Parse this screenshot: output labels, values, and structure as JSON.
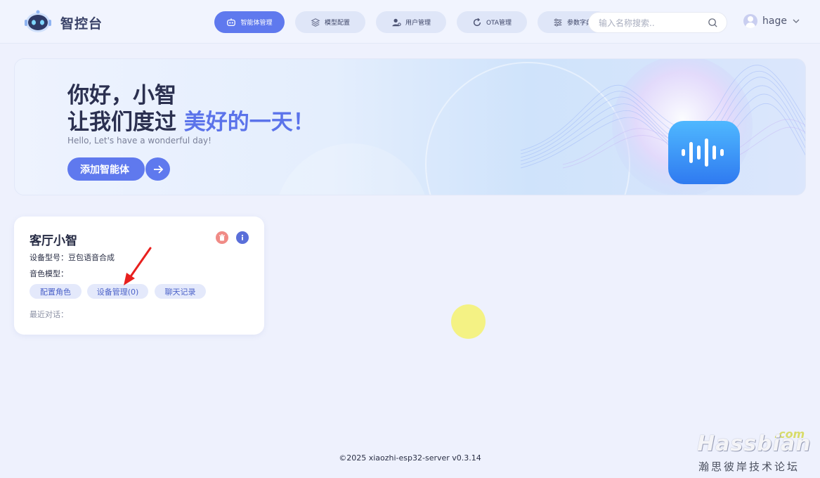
{
  "header": {
    "logo_text": "智控台",
    "nav": [
      {
        "label": "智能体管理",
        "icon": "robot-icon"
      },
      {
        "label": "模型配置",
        "icon": "layers-icon"
      },
      {
        "label": "用户管理",
        "icon": "user-manage-icon"
      },
      {
        "label": "OTA管理",
        "icon": "refresh-icon"
      },
      {
        "label": "参数字典",
        "icon": "sliders-icon"
      }
    ],
    "search_placeholder": "输入名称搜索..",
    "username": "hage"
  },
  "banner": {
    "greeting_line1": "你好，小智",
    "greeting_line2_prefix": "让我们度过 ",
    "greeting_line2_highlight": "美好的一天！",
    "subtitle": "Hello, Let's have a wonderful day!",
    "add_button": "添加智能体"
  },
  "agent_card": {
    "name": "客厅小智",
    "device_model_label": "设备型号：",
    "device_model_value": "豆包语音合成",
    "voice_model_label": "音色模型：",
    "voice_model_value": "",
    "actions": {
      "configure": "配置角色",
      "devices": "设备管理(0)",
      "chat_history": "聊天记录"
    },
    "recent_label": "最近对话："
  },
  "footer": "©2025 xiaozhi-esp32-server v0.3.14",
  "watermark": {
    "com": ".com",
    "brand": "Hassbian",
    "sub": "瀚思彼岸技术论坛"
  },
  "colors": {
    "accent": "#5f79ee",
    "background": "#eef1fd",
    "delete": "#f08b86",
    "info": "#5a6fd9",
    "annotation_arrow": "#e8201e"
  }
}
